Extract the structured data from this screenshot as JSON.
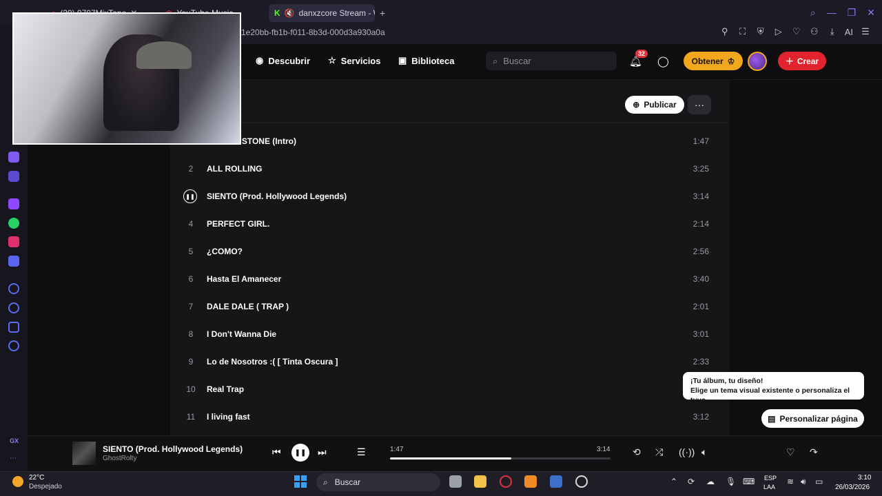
{
  "browser": {
    "tabs": [
      {
        "label": "(20) 0707MixTape",
        "active": false
      },
      {
        "label": "YouTube Music",
        "active": false
      },
      {
        "label": "danxzcore Stream - W",
        "active": true
      }
    ],
    "url": "1e20bb-fb1b-f011-8b3d-000d3a930a0a",
    "ai_label": "AI"
  },
  "nav": {
    "descubrir": "Descubrir",
    "servicios": "Servicios",
    "biblioteca": "Biblioteca",
    "search_placeholder": "Buscar",
    "notif_count": "32",
    "obtener": "Obtener",
    "crear": "Crear"
  },
  "panel": {
    "publicar": "Publicar",
    "more": "···"
  },
  "tracks": [
    {
      "num": "1",
      "title": "ROLLIN' STONE (Intro)",
      "duration": "1:47"
    },
    {
      "num": "2",
      "title": "ALL ROLLING",
      "duration": "3:25"
    },
    {
      "num": "3",
      "title": "SIENTO (Prod. Hollywood Legends)",
      "duration": "3:14",
      "playing": true
    },
    {
      "num": "4",
      "title": "PERFECT GIRL.",
      "duration": "2:14"
    },
    {
      "num": "5",
      "title": "¿COMO?",
      "duration": "2:56"
    },
    {
      "num": "6",
      "title": "Hasta El Amanecer",
      "duration": "3:40"
    },
    {
      "num": "7",
      "title": "DALE DALE ( TRAP )",
      "duration": "2:01"
    },
    {
      "num": "8",
      "title": "I Don't Wanna Die",
      "duration": "3:01"
    },
    {
      "num": "9",
      "title": "Lo de Nosotros :( [ Tinta Oscura ]",
      "duration": "2:33"
    },
    {
      "num": "10",
      "title": "Real Trap",
      "duration": ""
    },
    {
      "num": "11",
      "title": "I living fast",
      "duration": "3:12"
    }
  ],
  "tooltip": {
    "line1": "¡Tu álbum, tu diseño!",
    "line2": "Elige un tema visual existente o personaliza el tuyo."
  },
  "personalizar": "Personalizar página",
  "player": {
    "title": "SIENTO (Prod. Hollywood Legends)",
    "artist": "GhostRolty",
    "current_time": "1:47",
    "total_time": "3:14",
    "progress_fraction": 0.55
  },
  "taskbar": {
    "temp": "22°C",
    "weather": "Despejado",
    "search": "Buscar",
    "lang1": "ESP",
    "lang2": "LAA",
    "time": "3:10",
    "date": "26/03/2026"
  },
  "sidebar_label": "GX",
  "colors": {
    "accent_gold": "#f2a81d",
    "accent_red": "#e1232d",
    "opera_purple": "#8a7cf0"
  }
}
